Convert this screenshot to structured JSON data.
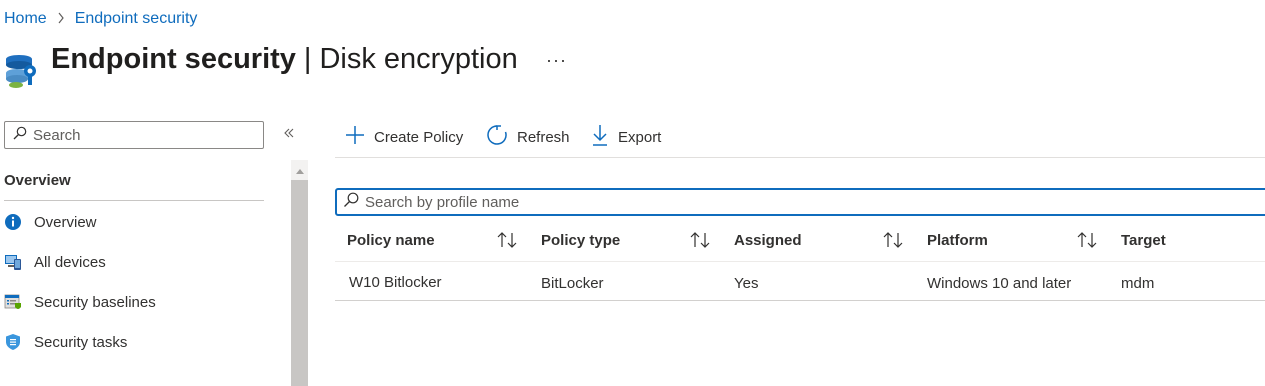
{
  "breadcrumb": {
    "home": "Home",
    "separator": ">",
    "current": "Endpoint security"
  },
  "header": {
    "title_bold": "Endpoint security",
    "separator": "|",
    "title_sub": "Disk encryption",
    "more_label": "···"
  },
  "sidebar": {
    "search_placeholder": "Search",
    "collapse_icon": "double-chevron-left",
    "section_title": "Overview",
    "items": [
      {
        "label": "Overview",
        "icon": "info-icon"
      },
      {
        "label": "All devices",
        "icon": "devices-icon"
      },
      {
        "label": "Security baselines",
        "icon": "baselines-icon"
      },
      {
        "label": "Security tasks",
        "icon": "shield-tasks-icon"
      }
    ]
  },
  "toolbar": {
    "create_label": "Create Policy",
    "refresh_label": "Refresh",
    "export_label": "Export"
  },
  "grid": {
    "search_placeholder": "Search by profile name",
    "columns": [
      "Policy name",
      "Policy type",
      "Assigned",
      "Platform",
      "Target"
    ],
    "rows": [
      [
        "W10 Bitlocker",
        "BitLocker",
        "Yes",
        "Windows 10 and later",
        "mdm"
      ]
    ]
  },
  "colors": {
    "link": "#0f6cbd",
    "accent": "#0f6cbd",
    "text": "#323130"
  }
}
